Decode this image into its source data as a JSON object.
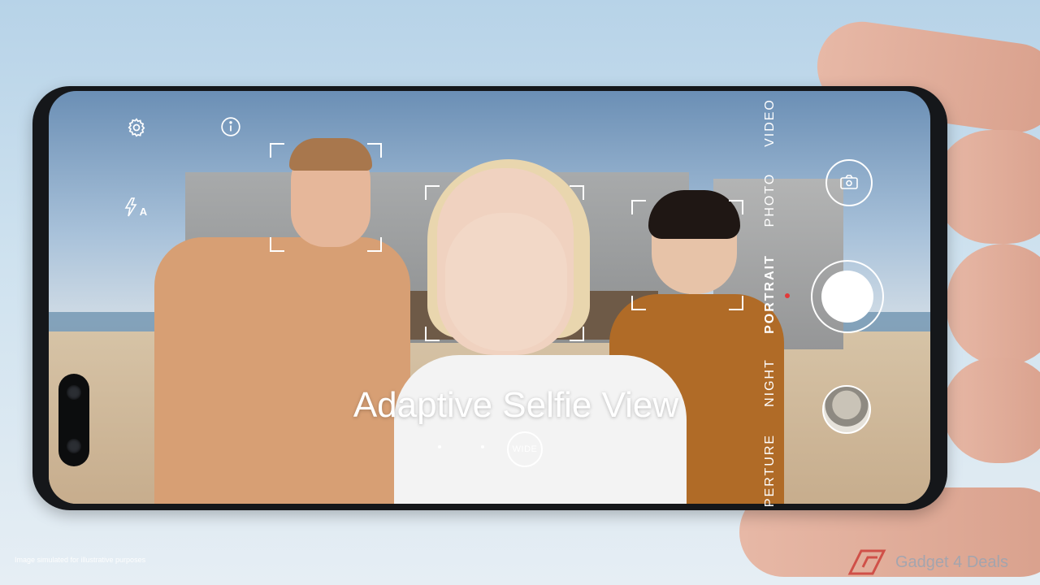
{
  "caption": "Adaptive Selfie View",
  "disclaimer": "Image simulated for illustrative purposes",
  "watermark": "Gadget 4 Deals",
  "camera": {
    "modes": [
      {
        "label": "VIDEO",
        "active": false
      },
      {
        "label": "PHOTO",
        "active": false
      },
      {
        "label": "PORTRAIT",
        "active": true
      },
      {
        "label": "NIGHT",
        "active": false
      },
      {
        "label": "PERTURE",
        "active": false
      }
    ],
    "zoom_label": "WIDE",
    "flash_label": "A",
    "icons": [
      "settings-icon",
      "info-icon",
      "flash-auto-icon",
      "switch-camera-icon",
      "shutter-button",
      "gallery-thumbnail"
    ]
  },
  "colors": {
    "sky": "#b7d3e8",
    "phone_frame": "#15171a",
    "active_indicator": "#e23a3a"
  }
}
